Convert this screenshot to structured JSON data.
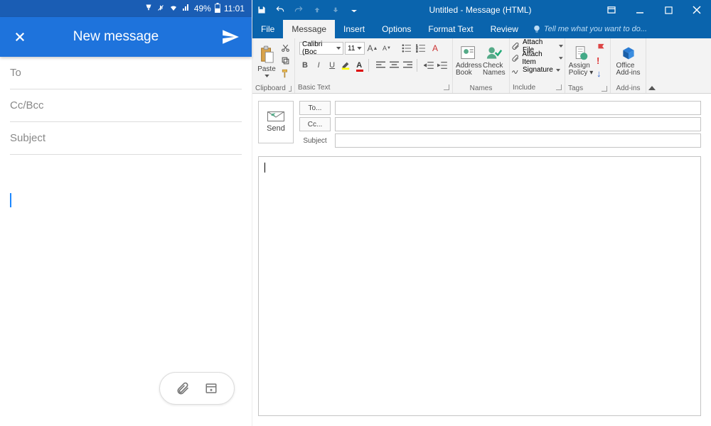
{
  "mobile": {
    "status": {
      "battery": "49%",
      "time": "11:01"
    },
    "header": {
      "title": "New message"
    },
    "fields": {
      "to": "To",
      "ccbcc": "Cc/Bcc",
      "subject": "Subject"
    }
  },
  "outlook": {
    "titlebar": {
      "title": "Untitled - Message (HTML)"
    },
    "tabs": {
      "items": [
        "File",
        "Message",
        "Insert",
        "Options",
        "Format Text",
        "Review"
      ],
      "active": "Message",
      "tellme": "Tell me what you want to do..."
    },
    "ribbon": {
      "clipboard": {
        "label": "Clipboard",
        "paste": "Paste"
      },
      "basictext": {
        "label": "Basic Text",
        "fontname": "Calibri (Boc",
        "fontsize": "11"
      },
      "names": {
        "label": "Names",
        "address": "Address Book",
        "check": "Check Names"
      },
      "include": {
        "label": "Include",
        "attachfile": "Attach File",
        "attachitem": "Attach Item",
        "signature": "Signature"
      },
      "tags": {
        "label": "Tags",
        "assign": "Assign Policy"
      },
      "addins": {
        "label": "Add-ins",
        "office": "Office Add-ins"
      }
    },
    "compose": {
      "send": "Send",
      "to": "To...",
      "cc": "Cc...",
      "subject": "Subject"
    }
  }
}
